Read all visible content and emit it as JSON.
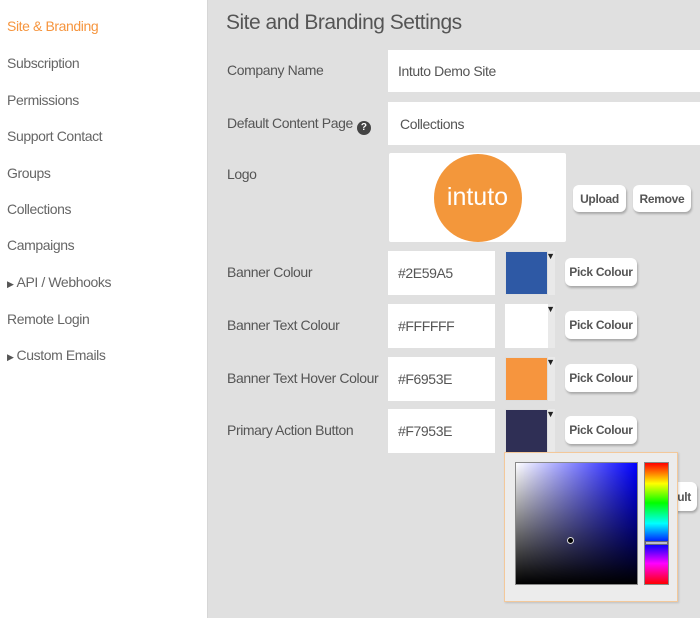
{
  "sidebar": {
    "items": [
      {
        "label": "Site & Branding",
        "active": true
      },
      {
        "label": "Subscription"
      },
      {
        "label": "Permissions"
      },
      {
        "label": "Support Contact"
      },
      {
        "label": "Groups"
      },
      {
        "label": "Collections"
      },
      {
        "label": "Campaigns"
      },
      {
        "label": "API / Webhooks",
        "expandable": true
      },
      {
        "label": "Remote Login"
      },
      {
        "label": "Custom Emails",
        "expandable": true
      }
    ]
  },
  "main": {
    "title": "Site and Branding Settings",
    "company_name": {
      "label": "Company Name",
      "value": "Intuto Demo Site"
    },
    "default_page": {
      "label": "Default Content Page",
      "value": "Collections",
      "help_icon": "?"
    },
    "logo": {
      "label": "Logo",
      "logo_text": "intuto",
      "upload": "Upload",
      "remove": "Remove"
    },
    "colours": [
      {
        "label": "Banner Colour",
        "value": "#2E59A5",
        "swatch": "#2e59a5",
        "button": "Pick Colour"
      },
      {
        "label": "Banner Text Colour",
        "value": "#FFFFFF",
        "swatch": "#ffffff",
        "button": "Pick Colour"
      },
      {
        "label": "Banner Text Hover Colour",
        "value": "#F6953E",
        "swatch": "#f6953e",
        "button": "Pick Colour"
      },
      {
        "label": "Primary Action Button",
        "value": "#F7953E",
        "swatch": "#2f2f55",
        "button": "Pick Colour"
      }
    ],
    "hidden_button_fragment": "ult",
    "accent": "#f6953e"
  }
}
